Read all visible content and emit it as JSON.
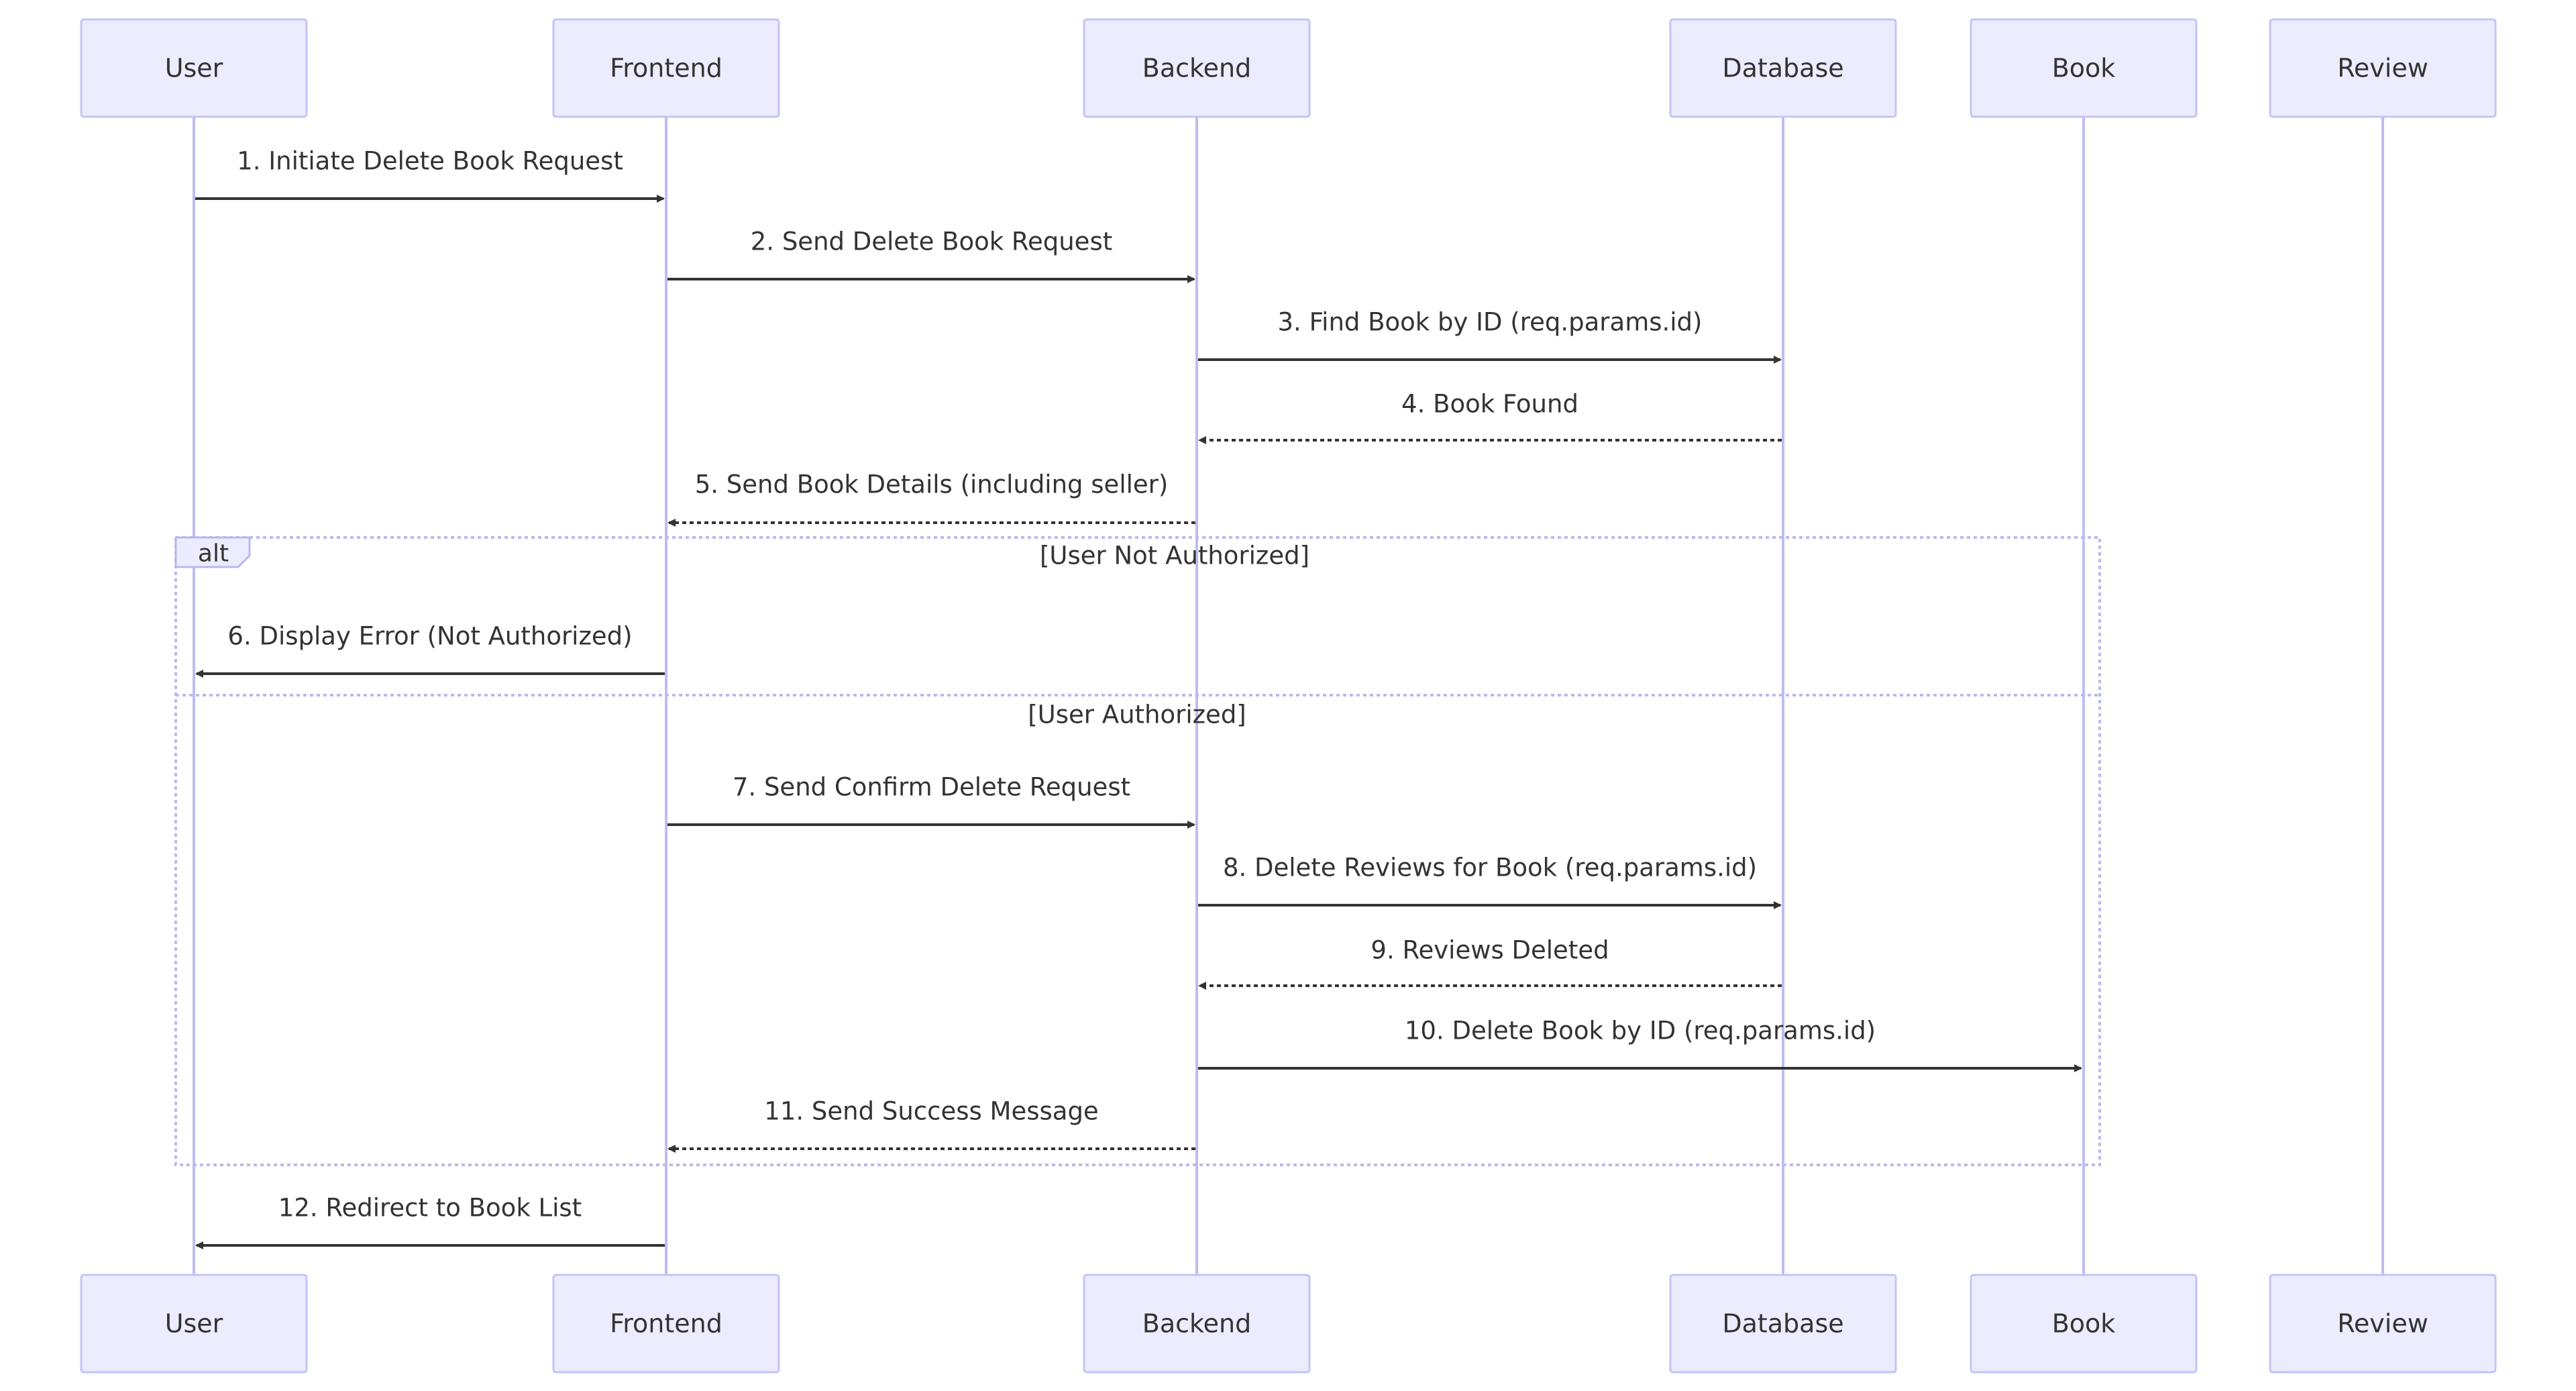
{
  "diagram": {
    "type": "sequence",
    "actors": [
      {
        "id": "user",
        "label": "User"
      },
      {
        "id": "frontend",
        "label": "Frontend"
      },
      {
        "id": "backend",
        "label": "Backend"
      },
      {
        "id": "database",
        "label": "Database"
      },
      {
        "id": "book",
        "label": "Book"
      },
      {
        "id": "review",
        "label": "Review"
      }
    ],
    "messages": [
      {
        "from": "user",
        "to": "frontend",
        "label": "1. Initiate Delete Book Request",
        "style": "solid"
      },
      {
        "from": "frontend",
        "to": "backend",
        "label": "2. Send Delete Book Request",
        "style": "solid"
      },
      {
        "from": "backend",
        "to": "database",
        "label": "3. Find Book by ID (req.params.id)",
        "style": "solid"
      },
      {
        "from": "database",
        "to": "backend",
        "label": "4. Book Found",
        "style": "dashed"
      },
      {
        "from": "backend",
        "to": "frontend",
        "label": "5. Send Book Details (including seller)",
        "style": "dashed"
      },
      {
        "from": "frontend",
        "to": "user",
        "label": "6. Display Error (Not Authorized)",
        "style": "solid"
      },
      {
        "from": "frontend",
        "to": "backend",
        "label": "7. Send Confirm Delete Request",
        "style": "solid"
      },
      {
        "from": "backend",
        "to": "database",
        "label": "8. Delete Reviews for Book (req.params.id)",
        "style": "solid"
      },
      {
        "from": "database",
        "to": "backend",
        "label": "9. Reviews Deleted",
        "style": "dashed"
      },
      {
        "from": "backend",
        "to": "book",
        "label": "10. Delete Book by ID (req.params.id)",
        "style": "solid"
      },
      {
        "from": "backend",
        "to": "frontend",
        "label": "11. Send Success Message",
        "style": "dashed"
      },
      {
        "from": "frontend",
        "to": "user",
        "label": "12. Redirect to Book List",
        "style": "solid"
      }
    ],
    "alt_block": {
      "label": "alt",
      "sections": [
        {
          "condition": "[User Not Authorized]"
        },
        {
          "condition": "[User Authorized]"
        }
      ]
    }
  },
  "colors": {
    "actor_fill": "#ECECFF",
    "actor_stroke": "#C4C4F5",
    "lifeline": "#BDBDF2",
    "message": "#333333"
  }
}
